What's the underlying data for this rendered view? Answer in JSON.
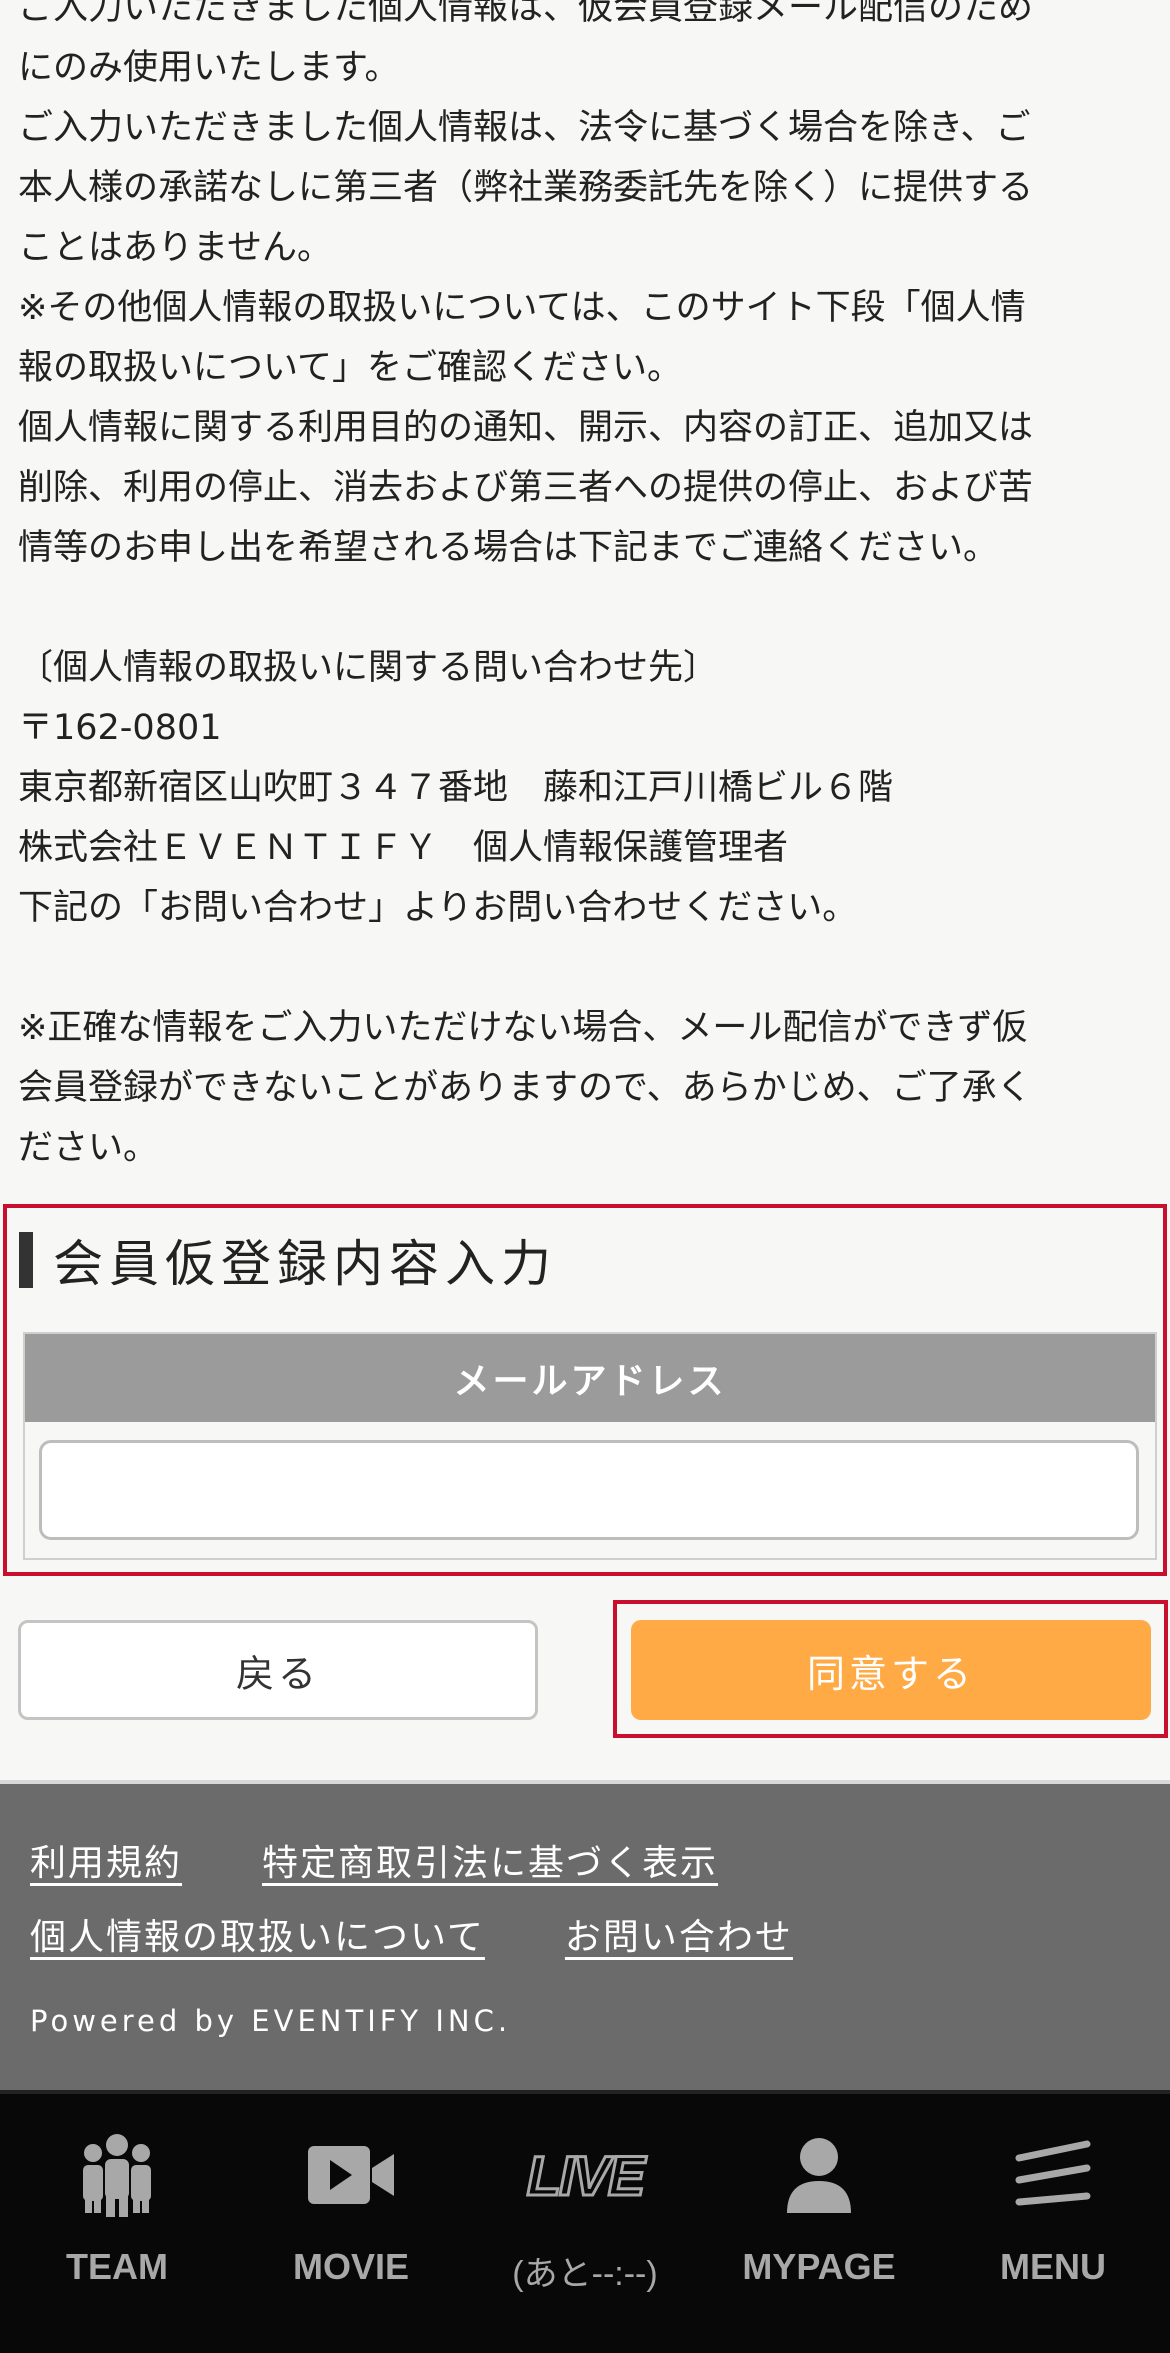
{
  "policy": {
    "lines": [
      "ご入力いただきました個人情報は、仮会員登録メール配信のため",
      "にのみ使用いたします。",
      "ご入力いただきました個人情報は、法令に基づく場合を除き、ご",
      "本人様の承諾なしに第三者（弊社業務委託先を除く）に提供する",
      "ことはありません。",
      "※その他個人情報の取扱いについては、このサイト下段「個人情",
      "報の取扱いについて」をご確認ください。",
      "個人情報に関する利用目的の通知、開示、内容の訂正、追加又は",
      "削除、利用の停止、消去および第三者への提供の停止、および苦",
      "情等のお申し出を希望される場合は下記までご連絡ください。"
    ],
    "contact_heading": "〔個人情報の取扱いに関する問い合わせ先〕",
    "postal": "〒162-0801",
    "address": "東京都新宿区山吹町３４７番地　藤和江戸川橋ビル６階",
    "company": "株式会社ＥＶＥＮＴＩＦＹ　個人情報保護管理者",
    "contact_note": "下記の「お問い合わせ」よりお問い合わせください。",
    "warning_lines": [
      "※正確な情報をご入力いただけない場合、メール配信ができず仮",
      "会員登録ができないことがありますので、あらかじめ、ご了承く",
      "ださい。"
    ]
  },
  "form": {
    "section_title": "会員仮登録内容入力",
    "email_label": "メールアドレス",
    "email_value": "",
    "email_placeholder": ""
  },
  "buttons": {
    "back": "戻る",
    "agree": "同意する"
  },
  "footer": {
    "links_row1": [
      "利用規約",
      "特定商取引法に基づく表示"
    ],
    "links_row2": [
      "個人情報の取扱いについて",
      "お問い合わせ"
    ],
    "powered": "Powered by EVENTIFY INC."
  },
  "tabbar": {
    "team": "TEAM",
    "movie": "MOVIE",
    "live_icon_text": "LIVE",
    "live": "(あと--:--)",
    "mypage": "MYPAGE",
    "menu": "MENU"
  },
  "colors": {
    "accent_orange": "#ffaa44",
    "highlight_red": "#c8102e",
    "footer_gray": "#6b6b6b",
    "tabbar_bg": "#080808"
  },
  "icons": [
    "team-icon",
    "movie-icon",
    "live-icon",
    "mypage-icon",
    "menu-icon"
  ]
}
